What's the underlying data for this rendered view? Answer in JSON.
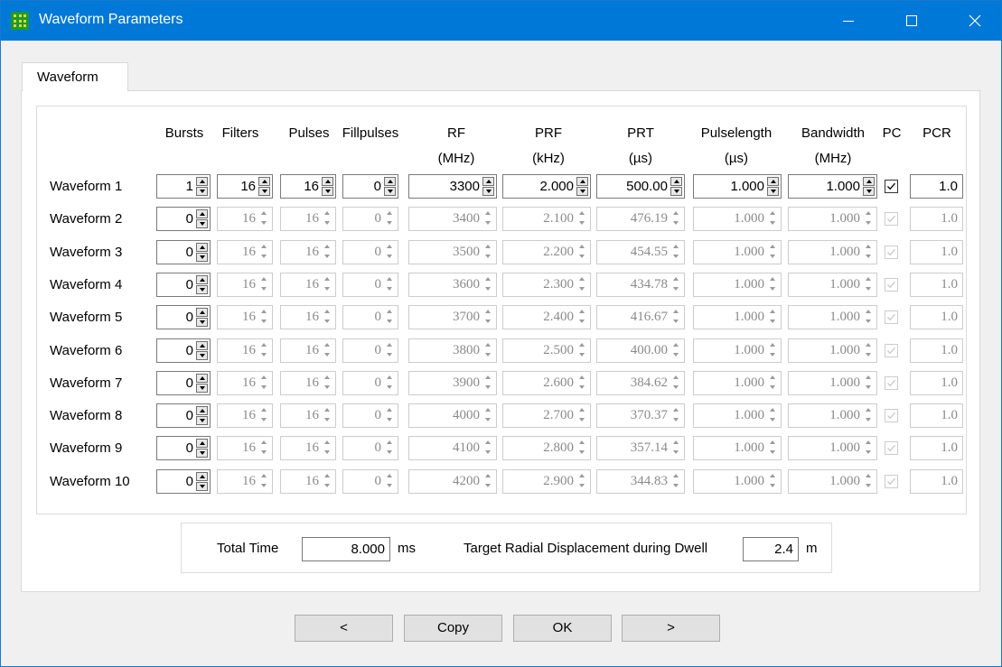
{
  "window": {
    "title": "Waveform Parameters",
    "minimize": "",
    "maximize": "",
    "close": ""
  },
  "tab": {
    "label": "Waveform"
  },
  "headers": {
    "bursts": "Bursts",
    "filters": "Filters",
    "pulses": "Pulses",
    "fillpulses": "Fillpulses",
    "rf": "RF",
    "rf_unit": "(MHz)",
    "prf": "PRF",
    "prf_unit": "(kHz)",
    "prt": "PRT",
    "prt_unit": "(µs)",
    "pulselength": "Pulselength",
    "pulselength_unit": "(µs)",
    "bandwidth": "Bandwidth",
    "bandwidth_unit": "(MHz)",
    "pc": "PC",
    "pcr": "PCR"
  },
  "rows": [
    {
      "label": "Waveform 1",
      "bursts": "1",
      "filters": "16",
      "pulses": "16",
      "fillpulses": "0",
      "rf": "3300",
      "prf": "2.000",
      "prt": "500.00",
      "pulselength": "1.000",
      "bandwidth": "1.000",
      "pc": true,
      "pcr": "1.0",
      "enabled": true
    },
    {
      "label": "Waveform 2",
      "bursts": "0",
      "filters": "16",
      "pulses": "16",
      "fillpulses": "0",
      "rf": "3400",
      "prf": "2.100",
      "prt": "476.19",
      "pulselength": "1.000",
      "bandwidth": "1.000",
      "pc": true,
      "pcr": "1.0",
      "enabled": false
    },
    {
      "label": "Waveform 3",
      "bursts": "0",
      "filters": "16",
      "pulses": "16",
      "fillpulses": "0",
      "rf": "3500",
      "prf": "2.200",
      "prt": "454.55",
      "pulselength": "1.000",
      "bandwidth": "1.000",
      "pc": true,
      "pcr": "1.0",
      "enabled": false
    },
    {
      "label": "Waveform 4",
      "bursts": "0",
      "filters": "16",
      "pulses": "16",
      "fillpulses": "0",
      "rf": "3600",
      "prf": "2.300",
      "prt": "434.78",
      "pulselength": "1.000",
      "bandwidth": "1.000",
      "pc": true,
      "pcr": "1.0",
      "enabled": false
    },
    {
      "label": "Waveform 5",
      "bursts": "0",
      "filters": "16",
      "pulses": "16",
      "fillpulses": "0",
      "rf": "3700",
      "prf": "2.400",
      "prt": "416.67",
      "pulselength": "1.000",
      "bandwidth": "1.000",
      "pc": true,
      "pcr": "1.0",
      "enabled": false
    },
    {
      "label": "Waveform 6",
      "bursts": "0",
      "filters": "16",
      "pulses": "16",
      "fillpulses": "0",
      "rf": "3800",
      "prf": "2.500",
      "prt": "400.00",
      "pulselength": "1.000",
      "bandwidth": "1.000",
      "pc": true,
      "pcr": "1.0",
      "enabled": false
    },
    {
      "label": "Waveform 7",
      "bursts": "0",
      "filters": "16",
      "pulses": "16",
      "fillpulses": "0",
      "rf": "3900",
      "prf": "2.600",
      "prt": "384.62",
      "pulselength": "1.000",
      "bandwidth": "1.000",
      "pc": true,
      "pcr": "1.0",
      "enabled": false
    },
    {
      "label": "Waveform 8",
      "bursts": "0",
      "filters": "16",
      "pulses": "16",
      "fillpulses": "0",
      "rf": "4000",
      "prf": "2.700",
      "prt": "370.37",
      "pulselength": "1.000",
      "bandwidth": "1.000",
      "pc": true,
      "pcr": "1.0",
      "enabled": false
    },
    {
      "label": "Waveform 9",
      "bursts": "0",
      "filters": "16",
      "pulses": "16",
      "fillpulses": "0",
      "rf": "4100",
      "prf": "2.800",
      "prt": "357.14",
      "pulselength": "1.000",
      "bandwidth": "1.000",
      "pc": true,
      "pcr": "1.0",
      "enabled": false
    },
    {
      "label": "Waveform 10",
      "bursts": "0",
      "filters": "16",
      "pulses": "16",
      "fillpulses": "0",
      "rf": "4200",
      "prf": "2.900",
      "prt": "344.83",
      "pulselength": "1.000",
      "bandwidth": "1.000",
      "pc": true,
      "pcr": "1.0",
      "enabled": false
    }
  ],
  "summary": {
    "total_time_label": "Total Time",
    "total_time_value": "8.000",
    "total_time_unit": "ms",
    "displacement_label": "Target Radial Displacement during Dwell",
    "displacement_value": "2.4",
    "displacement_unit": "m"
  },
  "buttons": {
    "prev": "<",
    "copy": "Copy",
    "ok": "OK",
    "next": ">"
  },
  "colors": {
    "titlebar": "#0078d7",
    "disabled_text": "#8a8a8a",
    "disabled_border": "#cccccc"
  },
  "icons": {
    "app": "app-grid-icon",
    "minimize": "minimize-icon",
    "maximize": "maximize-icon",
    "close": "close-icon",
    "spin": "spin-arrows-icon",
    "check": "checkmark-icon"
  }
}
